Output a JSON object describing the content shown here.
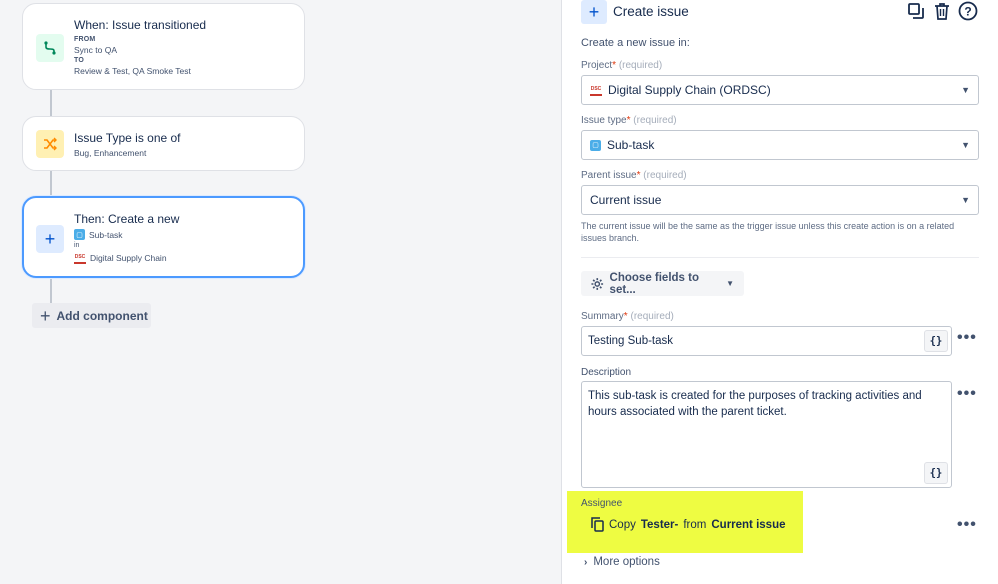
{
  "canvas": {
    "trigger": {
      "title": "When: Issue transitioned",
      "from_label": "FROM",
      "from_value": "Sync to QA",
      "to_label": "TO",
      "to_value": "Review & Test, QA Smoke Test"
    },
    "condition": {
      "title": "Issue Type is one of",
      "values": "Bug, Enhancement"
    },
    "action": {
      "title": "Then: Create a new",
      "issue_type": "Sub-task",
      "in_label": "in",
      "project": "Digital Supply Chain"
    },
    "add_component": "Add component"
  },
  "panel": {
    "title": "Create issue",
    "intro": "Create a new issue in:",
    "project_label": "Project",
    "required_text": "(required)",
    "project_value": "Digital Supply Chain (ORDSC)",
    "issue_type_label": "Issue type",
    "issue_type_value": "Sub-task",
    "parent_label": "Parent issue",
    "parent_value": "Current issue",
    "parent_help": "The current issue will be the same as the trigger issue unless this create action is on a related issues branch.",
    "choose_fields": "Choose fields to set...",
    "summary_label": "Summary",
    "summary_value": "Testing Sub-task",
    "description_label": "Description",
    "description_value": "This sub-task is created for the purposes of tracking activities and hours associated with the parent ticket.",
    "assignee_label": "Assignee",
    "assignee_copy": "Copy",
    "assignee_field": "Tester-",
    "assignee_from": "from",
    "assignee_source": "Current issue",
    "more_options": "More options",
    "braces": "{}",
    "star": "*"
  },
  "icons": {
    "trigger": "transition-icon",
    "condition": "shuffle-icon",
    "action": "plus-icon",
    "copy": "copy-icon",
    "delete": "trash-icon",
    "help": "help-icon",
    "settings": "gear-icon"
  },
  "colors": {
    "accent": "#0052cc",
    "highlight": "#eefc42",
    "selected_border": "#4c9aff"
  }
}
